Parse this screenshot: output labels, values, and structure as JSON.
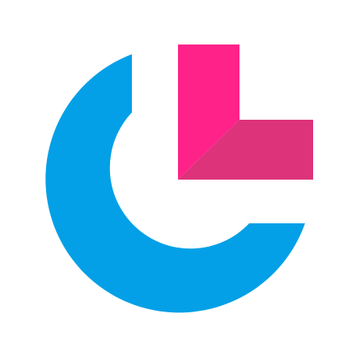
{
  "logo": {
    "name": "app-logo",
    "colors": {
      "background": "#ffffff",
      "ring": "#03a0e7",
      "l_upper": "#fe2289",
      "l_lower": "#dd337b"
    }
  }
}
